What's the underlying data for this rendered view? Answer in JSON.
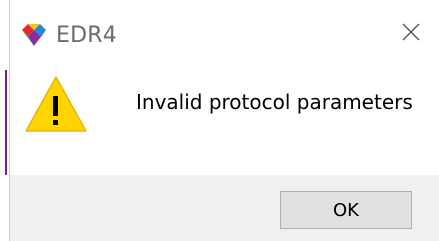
{
  "window": {
    "title": "EDR4",
    "app_icon": "colorful-diamond-icon",
    "close_icon": "close-icon"
  },
  "dialog": {
    "icon": "warning-icon",
    "message": "Invalid protocol parameters",
    "ok_label": "OK"
  },
  "colors": {
    "warning_fill": "#ffd400",
    "footer_bg": "#f0f0f0",
    "button_bg": "#e1e1e1",
    "title_text": "#6b6b6b"
  }
}
